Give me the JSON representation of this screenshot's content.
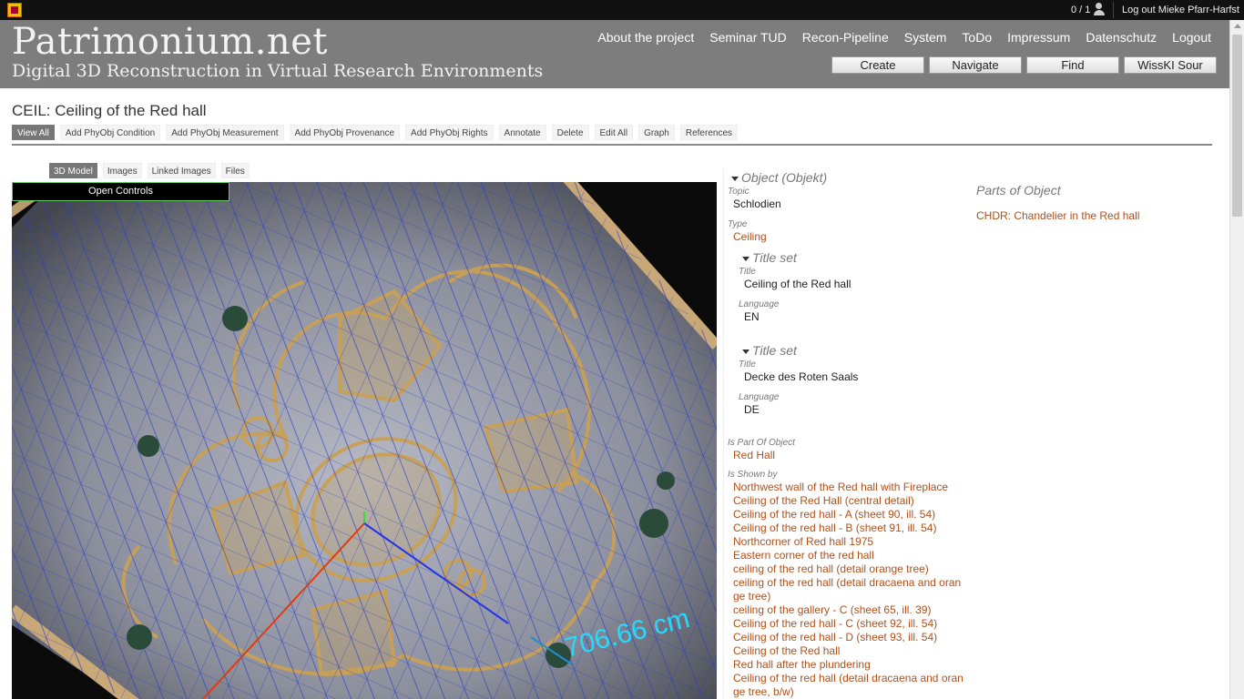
{
  "topbar": {
    "users_count": "0 / 1",
    "logout": "Log out Mieke Pfarr-Harfst"
  },
  "header": {
    "site_title": "Patrimonium.net",
    "site_subtitle": "Digital 3D Reconstruction in Virtual Research Environments",
    "nav": [
      "About the project",
      "Seminar TUD",
      "Recon-Pipeline",
      "System",
      "ToDo",
      "Impressum",
      "Datenschutz",
      "Logout"
    ],
    "buttons": [
      "Create",
      "Navigate",
      "Find",
      "WissKI Sour"
    ]
  },
  "page": {
    "title": "CEIL: Ceiling of the Red hall",
    "action_tabs": [
      "View All",
      "Add PhyObj Condition",
      "Add PhyObj Measurement",
      "Add PhyObj Provenance",
      "Add PhyObj Rights",
      "Annotate",
      "Delete",
      "Edit All",
      "Graph",
      "References"
    ],
    "active_action_tab": "View All",
    "sub_tabs": [
      "3D Model",
      "Images",
      "Linked Images",
      "Files"
    ],
    "active_sub_tab": "3D Model"
  },
  "viewer": {
    "open_controls": "Open Controls",
    "measurement": "706.66 cm"
  },
  "object": {
    "section": "Object (Objekt)",
    "topic_label": "Topic",
    "topic": "Schlodien",
    "type_label": "Type",
    "type": "Ceiling",
    "title_sets": [
      {
        "heading": "Title set",
        "title_label": "Title",
        "title": "Ceiling of the Red hall",
        "language_label": "Language",
        "language": "EN"
      },
      {
        "heading": "Title set",
        "title_label": "Title",
        "title": "Decke des Roten Saals",
        "language_label": "Language",
        "language": "DE"
      }
    ],
    "part_of_label": "Is Part Of Object",
    "part_of": "Red Hall",
    "shown_by_label": "Is Shown by",
    "shown_by": [
      "Northwest wall of the Red hall with Fireplace",
      "Ceiling of the Red Hall (central detail)",
      "Ceiling of the red hall - A (sheet 90, ill. 54)",
      "Ceiling of the red hall - B (sheet 91, ill. 54)",
      "Northcorner of Red hall 1975",
      "Eastern corner of the red hall",
      "ceiling of the red hall (detail orange tree)",
      "ceiling of the red hall (detail dracaena and orange tree)",
      "ceiling of the gallery - C (sheet 65, ill. 39)",
      "Ceiling of the red hall - C (sheet 92, ill. 54)",
      "Ceiling of the red hall - D (sheet 93, ill. 54)",
      "Ceiling of the Red hall",
      "Red hall after the plundering",
      "Ceiling of the red hall (detail dracaena and orange tree, b/w)"
    ]
  },
  "parts": {
    "heading": "Parts of Object",
    "items": [
      "CHDR: Chandelier in the Red hall"
    ]
  }
}
